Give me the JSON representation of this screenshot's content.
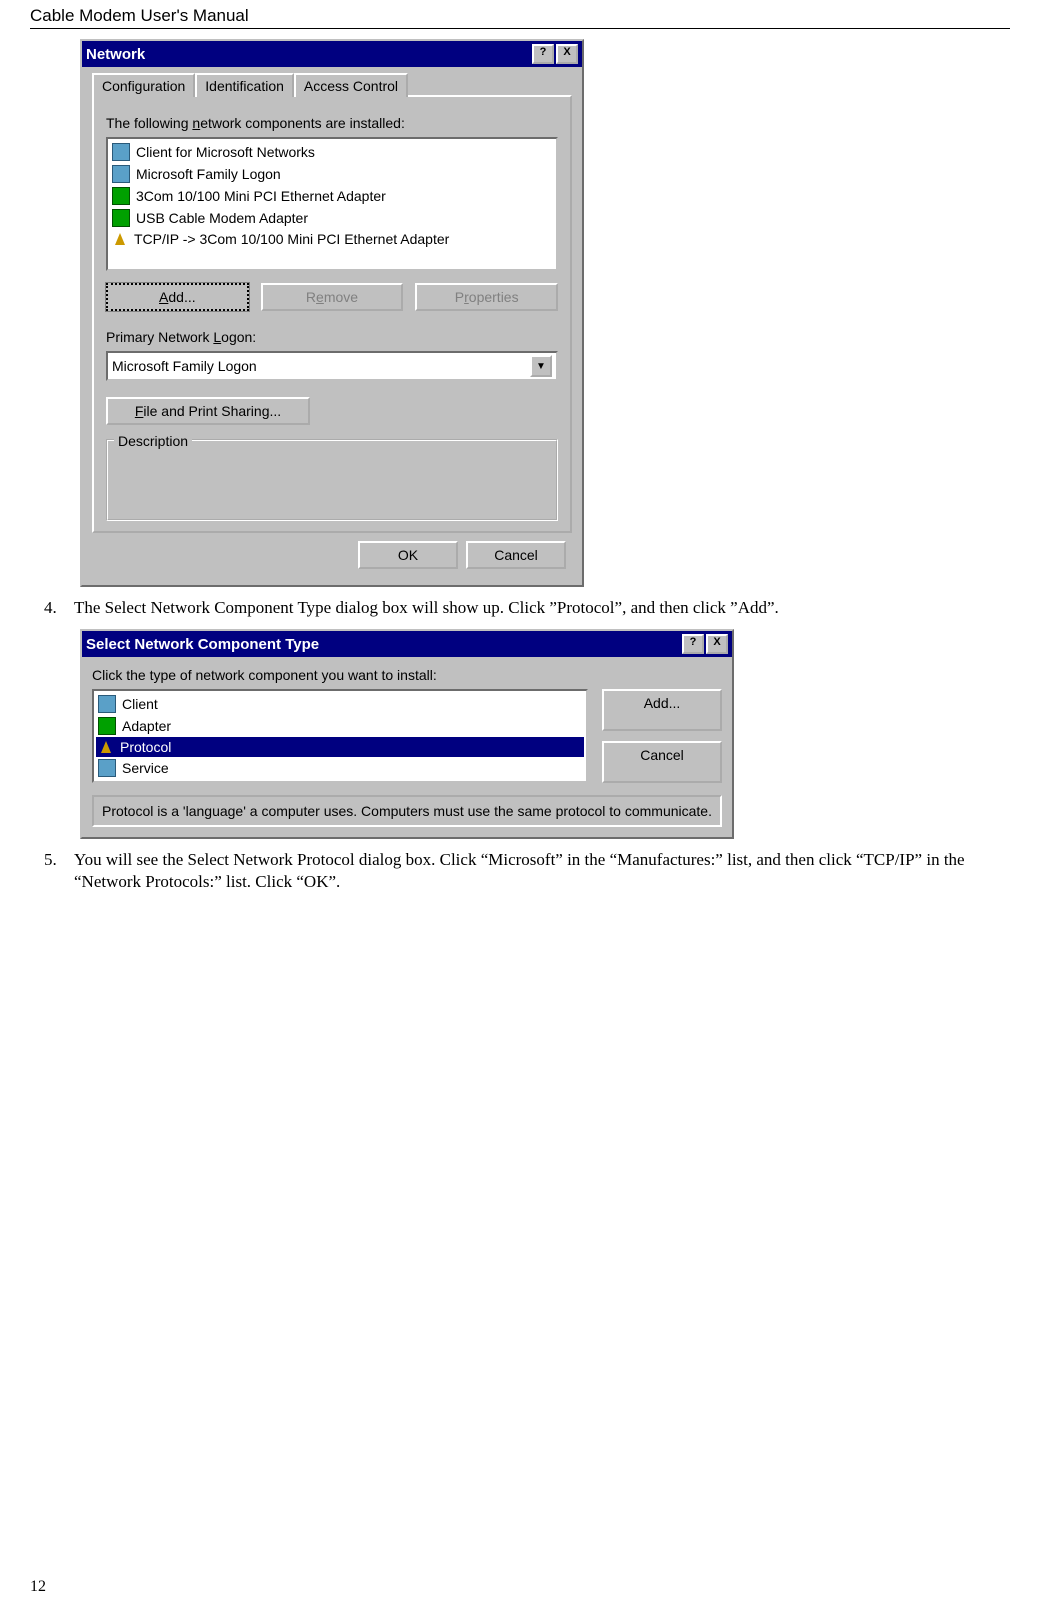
{
  "doc": {
    "header": "Cable Modem User's Manual",
    "page_number": "12",
    "step4_num": "4.",
    "step4_text": "The Select Network Component Type dialog box will show up. Click ”Protocol”, and then click ”Add”.",
    "step5_num": "5.",
    "step5_text": "You will see the Select Network Protocol dialog box. Click “Microsoft” in the “Manufactures:” list, and then click “TCP/IP” in the “Network Protocols:” list. Click “OK”."
  },
  "network_dialog": {
    "title": "Network",
    "help": "?",
    "close": "X",
    "tabs": [
      "Configuration",
      "Identification",
      "Access Control"
    ],
    "list_label": "The following network components are installed:",
    "items": [
      {
        "icon": "computer",
        "label": "Client for Microsoft Networks"
      },
      {
        "icon": "computer",
        "label": "Microsoft Family Logon"
      },
      {
        "icon": "card",
        "label": "3Com 10/100 Mini PCI Ethernet Adapter"
      },
      {
        "icon": "card",
        "label": "USB Cable Modem Adapter"
      },
      {
        "icon": "proto",
        "label": "TCP/IP -> 3Com 10/100 Mini PCI Ethernet Adapter"
      }
    ],
    "btn_add": "Add...",
    "btn_remove": "Remove",
    "btn_properties": "Properties",
    "primary_label": "Primary Network Logon:",
    "primary_value": "Microsoft Family Logon",
    "file_print": "File and Print Sharing...",
    "desc_legend": "Description",
    "ok": "OK",
    "cancel": "Cancel"
  },
  "component_dialog": {
    "title": "Select Network Component Type",
    "help": "?",
    "close": "X",
    "instruction": "Click the type of network component you want to install:",
    "items": [
      {
        "icon": "computer",
        "label": "Client",
        "selected": false
      },
      {
        "icon": "card",
        "label": "Adapter",
        "selected": false
      },
      {
        "icon": "proto",
        "label": "Protocol",
        "selected": true
      },
      {
        "icon": "computer",
        "label": "Service",
        "selected": false
      }
    ],
    "btn_add": "Add...",
    "btn_cancel": "Cancel",
    "hint": "Protocol is a 'language' a computer uses. Computers must use the same protocol to communicate."
  }
}
